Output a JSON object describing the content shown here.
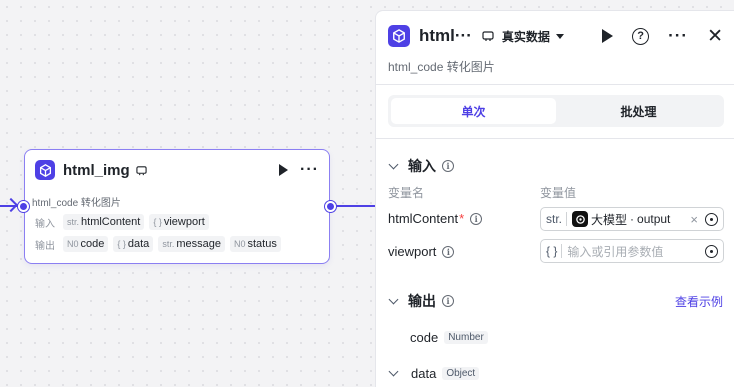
{
  "node": {
    "title": "html_img",
    "description": "html_code 转化图片",
    "inputs_label": "输入",
    "outputs_label": "输出",
    "inputs": [
      {
        "type": "str.",
        "name": "htmlContent"
      },
      {
        "type": "{ }",
        "name": "viewport"
      }
    ],
    "outputs": [
      {
        "type": "N0",
        "name": "code"
      },
      {
        "type": "{ }",
        "name": "data"
      },
      {
        "type": "str.",
        "name": "message"
      },
      {
        "type": "N0",
        "name": "status"
      }
    ]
  },
  "panel": {
    "title": "html···",
    "mode": "真实数据",
    "description": "html_code 转化图片",
    "tabs": [
      {
        "label": "单次",
        "active": true
      },
      {
        "label": "批处理",
        "active": false
      }
    ],
    "input_section": {
      "title": "输入",
      "col_name": "变量名",
      "col_value": "变量值",
      "rows": [
        {
          "name": "htmlContent",
          "required": "*",
          "type": "str.",
          "ref_source": "大模型",
          "ref_sep": "·",
          "ref_field": "output"
        },
        {
          "name": "viewport",
          "type": "{ }",
          "placeholder": "输入或引用参数值"
        }
      ]
    },
    "output_section": {
      "title": "输出",
      "link": "查看示例",
      "rows": [
        {
          "name": "code",
          "type": "Number"
        },
        {
          "name": "data",
          "type": "Object"
        }
      ]
    }
  },
  "colors": {
    "accent": "#4e40e5",
    "required": "#f53f3f",
    "text": "#1f2329",
    "muted": "#8f959e"
  }
}
